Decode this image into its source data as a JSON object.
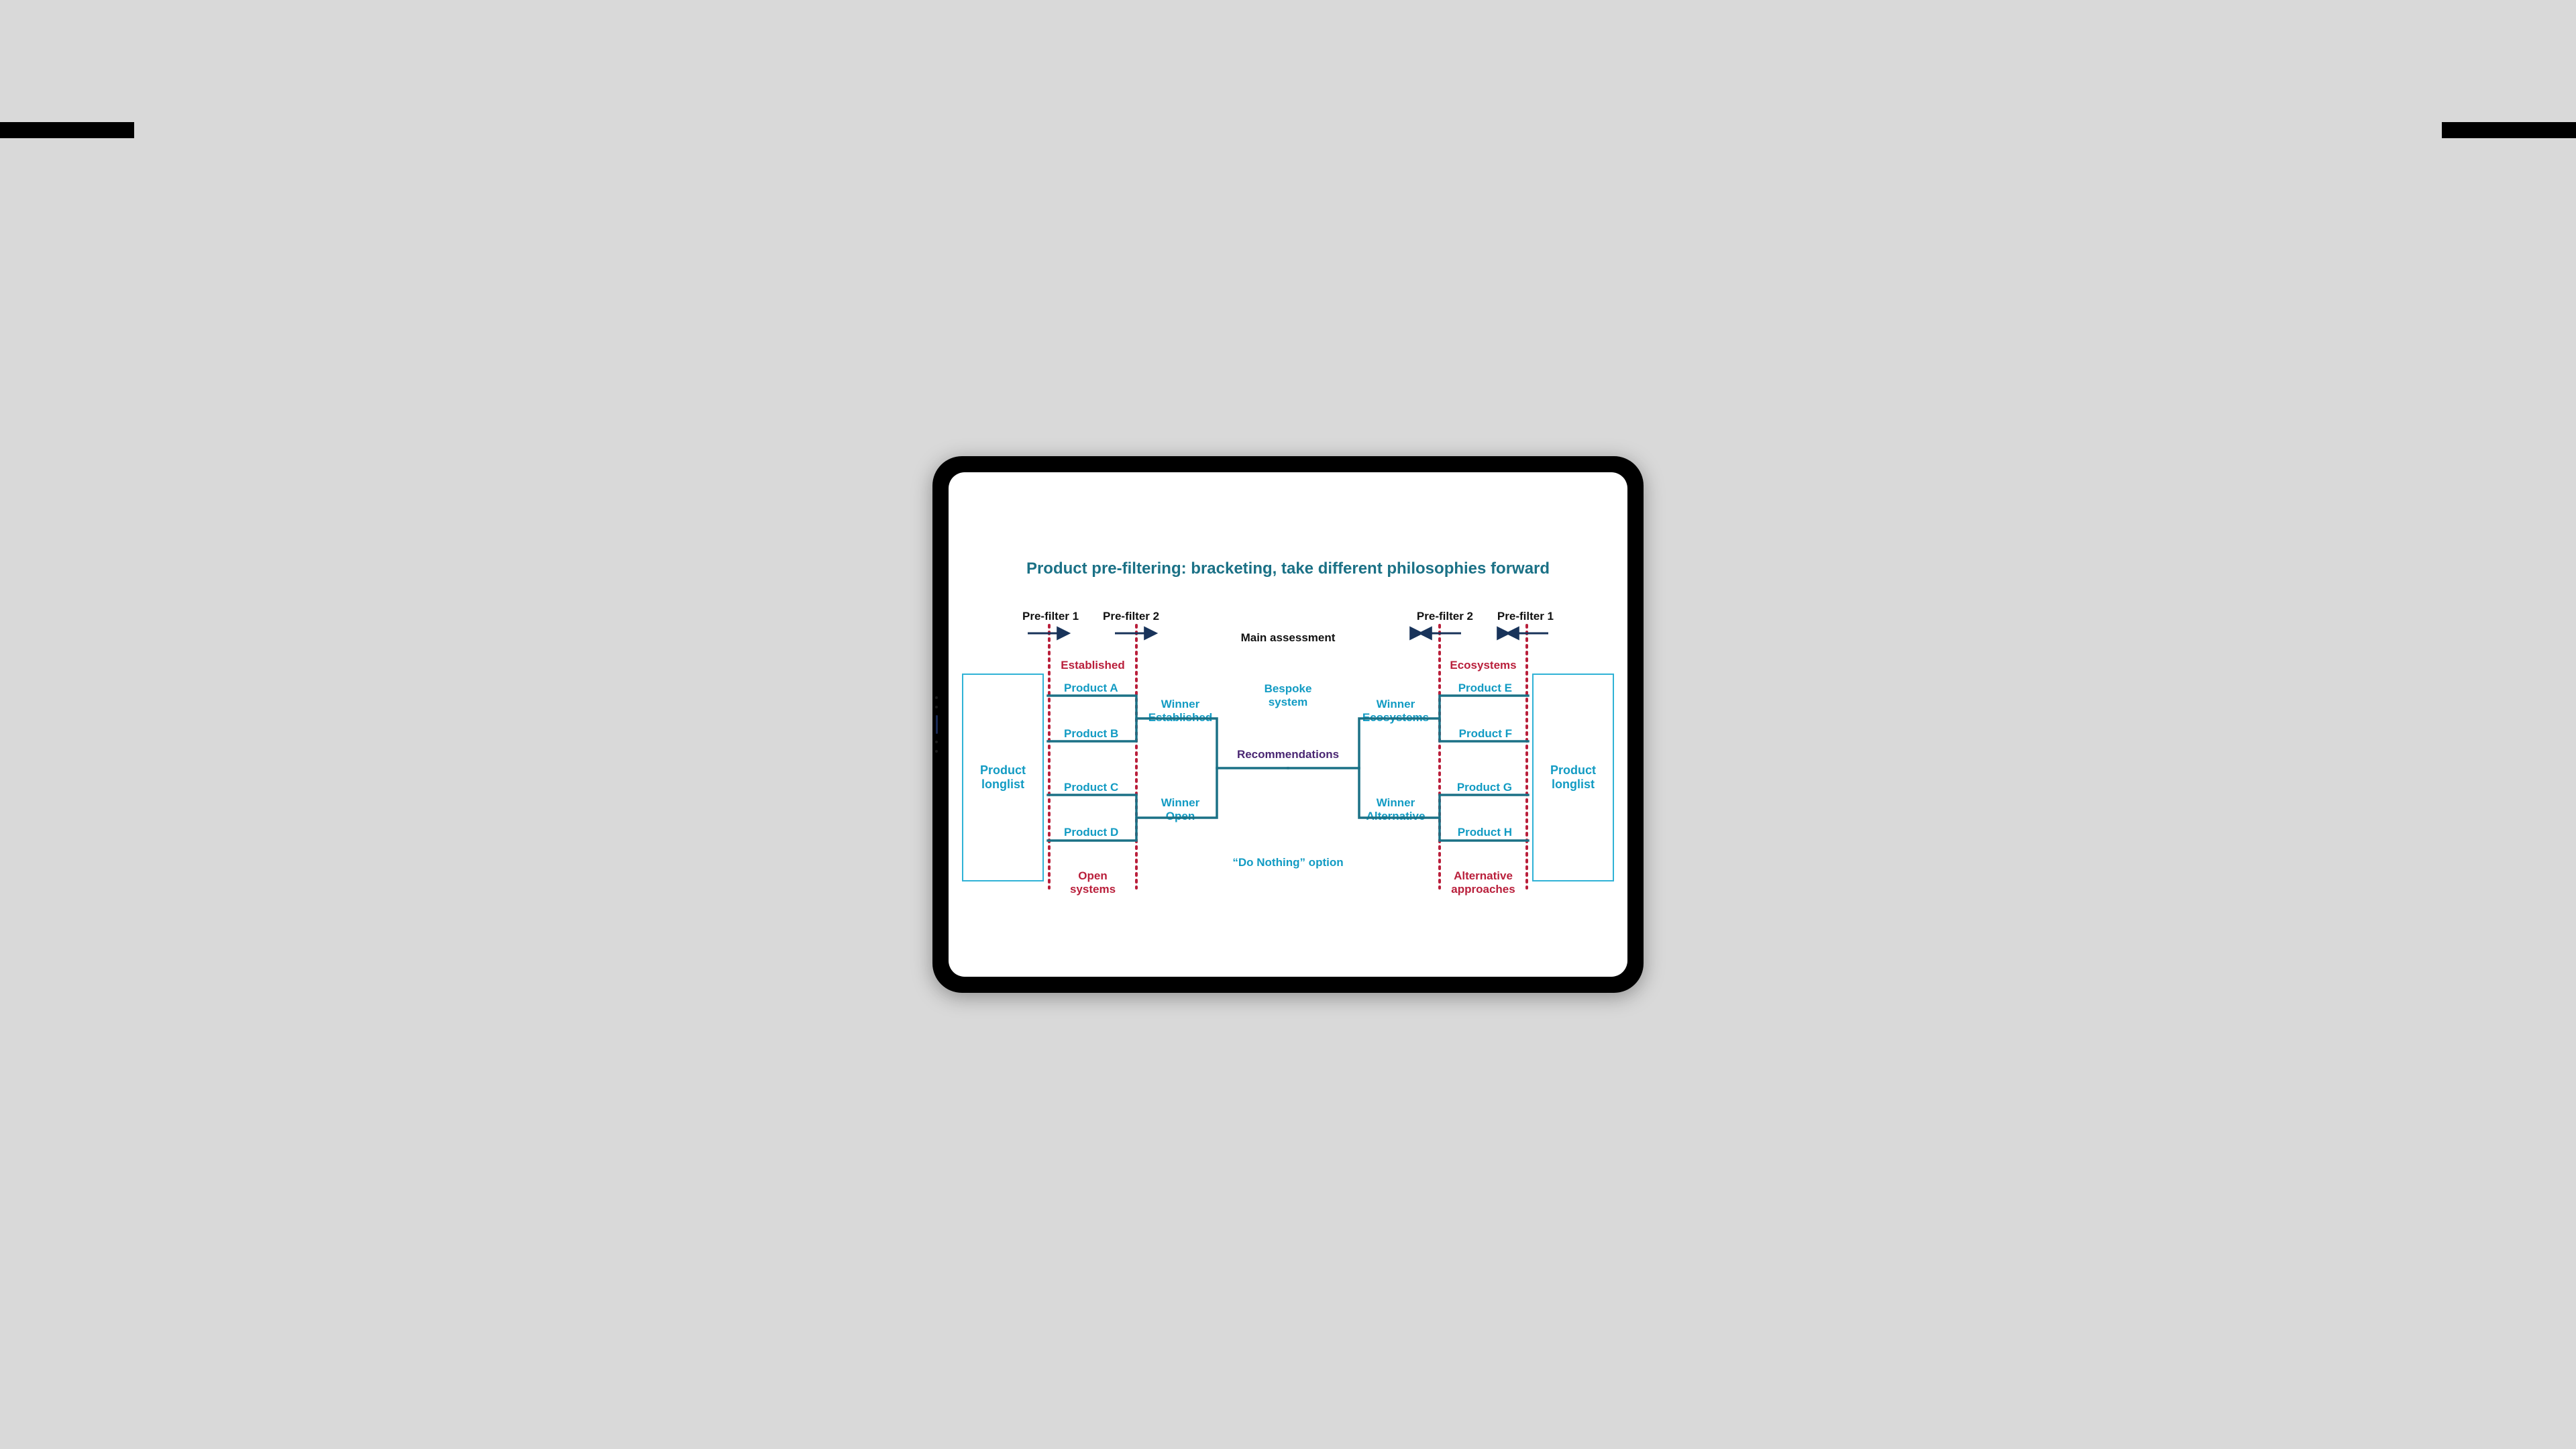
{
  "title": "Product pre-filtering: bracketing, take different philosophies forward",
  "headers": {
    "pre1_left": "Pre-filter 1",
    "pre2_left": "Pre-filter 2",
    "main": "Main assessment",
    "pre2_right": "Pre-filter 2",
    "pre1_right": "Pre-filter 1"
  },
  "left": {
    "longlist": "Product\nlonglist",
    "group_top": "Established",
    "group_bottom": "Open\nsystems",
    "products": [
      "Product A",
      "Product B",
      "Product C",
      "Product D"
    ],
    "winner_top": "Winner\nEstablished",
    "winner_bottom": "Winner\nOpen"
  },
  "right": {
    "longlist": "Product\nlonglist",
    "group_top": "Ecosystems",
    "group_bottom": "Alternative\napproaches",
    "products": [
      "Product E",
      "Product F",
      "Product G",
      "Product H"
    ],
    "winner_top": "Winner\nEcosystems",
    "winner_bottom": "Winner\nAlternative"
  },
  "center": {
    "top": "Bespoke\nsystem",
    "mid": "Recommendations",
    "bottom": "“Do Nothing” option"
  },
  "colors": {
    "teal": "#129bc3",
    "teal_dark": "#1b7186",
    "red": "#b91f3b",
    "navy": "#18335a",
    "purple": "#4a2672",
    "bracket": "#1b7186"
  }
}
